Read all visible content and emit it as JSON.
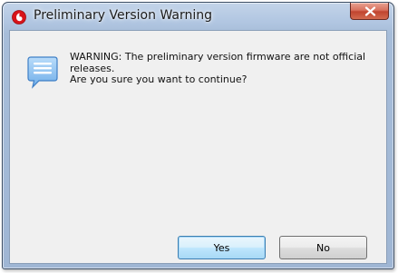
{
  "window": {
    "title": "Preliminary Version Warning"
  },
  "message": {
    "line1": "WARNING: The preliminary version firmware are not official",
    "line2": "releases.",
    "line3": "Are you sure you want to continue?"
  },
  "buttons": {
    "yes_label": "Yes",
    "no_label": "No"
  },
  "icons": {
    "app": "app-icon",
    "close": "close-icon",
    "message": "message-icon"
  },
  "colors": {
    "title_bar": "#b2c7e2",
    "close_button": "#c0442f",
    "dialog_background": "#f0f0f0",
    "default_button_border": "#3c7fb1"
  }
}
